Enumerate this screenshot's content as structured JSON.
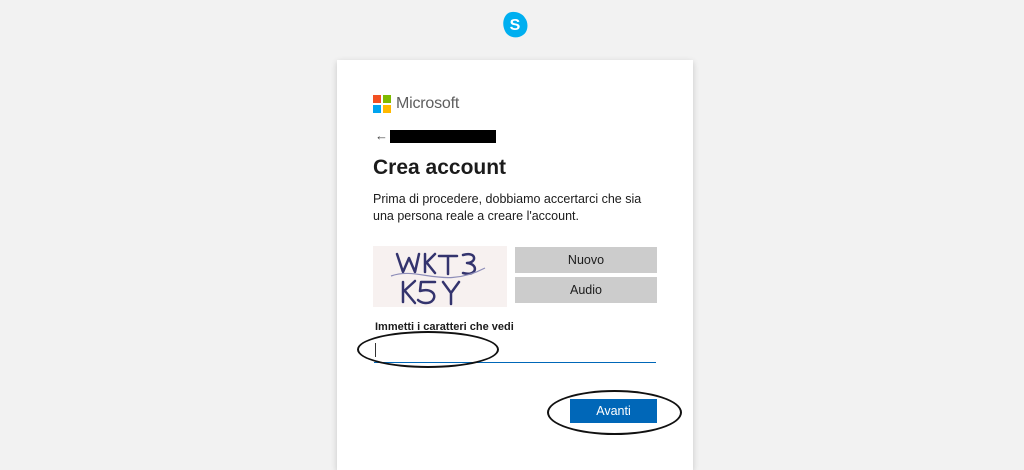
{
  "app": {
    "logo_icon": "skype-icon",
    "brand_color": "#00aff0"
  },
  "header": {
    "brand_name": "Microsoft",
    "logo_colors": [
      "#f25022",
      "#7fba00",
      "#00a4ef",
      "#ffb900"
    ],
    "back_icon": "back-arrow-icon",
    "back_arrow": "←"
  },
  "main": {
    "title": "Crea account",
    "description": "Prima di procedere, dobbiamo accertarci che sia una persona reale a creare l'account.",
    "captcha": {
      "image_text": "WKT3 K5Y",
      "new_label": "Nuovo",
      "audio_label": "Audio"
    },
    "input": {
      "label": "Immetti i caratteri che vedi",
      "value": "",
      "placeholder": ""
    },
    "next_label": "Avanti"
  },
  "colors": {
    "accent": "#0067b8",
    "captcha_button_bg": "#cccccc"
  }
}
